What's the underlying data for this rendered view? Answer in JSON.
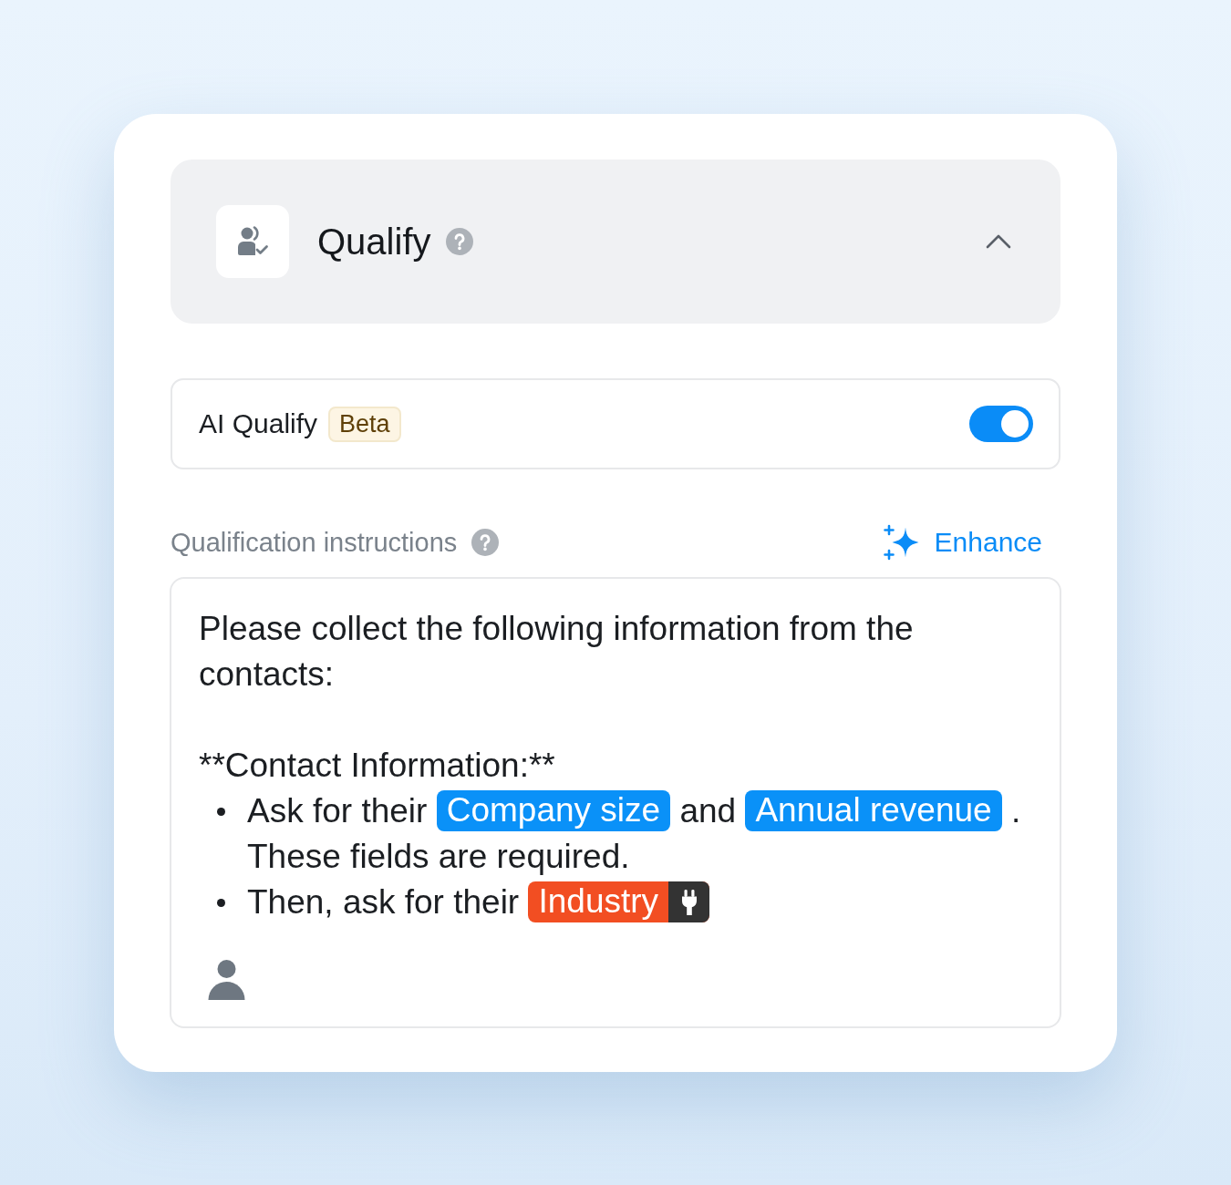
{
  "panel": {
    "title": "Qualify",
    "expanded": true
  },
  "ai_qualify": {
    "label": "AI Qualify",
    "badge": "Beta",
    "on": true
  },
  "instructions": {
    "label": "Qualification instructions",
    "enhance_button": "Enhance",
    "blocks": [
      {
        "kind": "paragraph",
        "text": "Please collect the following information from the contacts:"
      },
      {
        "kind": "paragraph",
        "text": "**Contact Information:**"
      },
      {
        "kind": "bullets",
        "items": [
          {
            "segments": [
              {
                "kind": "text",
                "text": "Ask for their"
              },
              {
                "kind": "tag",
                "text": "Company size",
                "color": "#0a91f8"
              },
              {
                "kind": "text",
                "text": "and"
              },
              {
                "kind": "tag",
                "text": "Annual revenue",
                "color": "#0a91f8"
              },
              {
                "kind": "text",
                "text": "."
              },
              {
                "kind": "text",
                "text": "These fields are required."
              }
            ]
          },
          {
            "segments": [
              {
                "kind": "text",
                "text": "Then, ask for their"
              },
              {
                "kind": "linked_tag",
                "text": "Industry",
                "color": "#f24e22"
              }
            ]
          }
        ]
      }
    ]
  }
}
